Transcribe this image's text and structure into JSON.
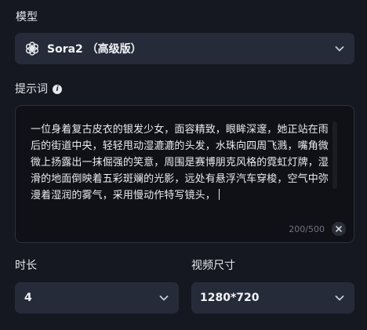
{
  "model": {
    "label": "模型",
    "selected": "Sora2 （高级版）",
    "logo_icon": "openai-logo-icon"
  },
  "prompt": {
    "label": "提示词",
    "info_icon": "info-icon",
    "value": "一位身着复古皮衣的银发少女，面容精致，眼眸深邃，她正站在雨后的街道中央，轻轻甩动湿漉漉的头发，水珠向四周飞溅，嘴角微微上扬露出一抹倔强的笑意，周围是赛博朋克风格的霓虹灯牌，湿滑的地面倒映着五彩斑斓的光影，远处有悬浮汽车穿梭，空气中弥漫着湿润的雾气，采用慢动作特写镜头，",
    "counter": "200/500"
  },
  "duration": {
    "label": "时长",
    "selected": "4"
  },
  "video_size": {
    "label": "视频尺寸",
    "selected": "1280*720"
  },
  "colors": {
    "background": "#151821",
    "field_bg": "#262b39",
    "textarea_bg": "#0f1116"
  }
}
